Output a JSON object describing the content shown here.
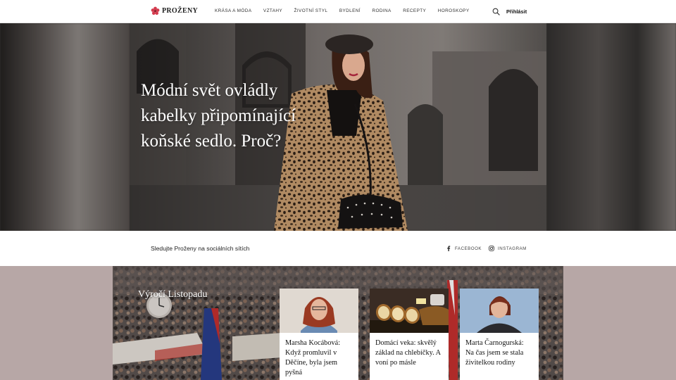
{
  "brand": {
    "name": "PROŽENY",
    "accent": "#d43b4e"
  },
  "nav": {
    "items": [
      {
        "label": "KRÁSA A MÓDA"
      },
      {
        "label": "VZTAHY"
      },
      {
        "label": "ŽIVOTNÍ STYL"
      },
      {
        "label": "BYDLENÍ"
      },
      {
        "label": "RODINA"
      },
      {
        "label": "RECEPTY"
      },
      {
        "label": "HOROSKOPY"
      }
    ],
    "search_icon": "search-icon",
    "login_label": "Přihlásit"
  },
  "hero": {
    "title": "Módní svět ovládly kabelky připomínající koňské sedlo. Proč?"
  },
  "social": {
    "text": "Sledujte Proženy na sociálních sítích",
    "facebook_label": "FACEBOOK",
    "instagram_label": "INSTAGRAM"
  },
  "section": {
    "title": "Výročí Listopadu",
    "background": "#b7a7a6",
    "cards": [
      {
        "title": "Marsha Kocábová: Když promluvil v Děčíne, byla jsem pyšná"
      },
      {
        "title": "Domácí veka: skvělý základ na chlebíčky. A voní po másle"
      },
      {
        "title": "Marta Čarnogurská: Na čas jsem se stala živitelkou rodiny"
      }
    ]
  }
}
